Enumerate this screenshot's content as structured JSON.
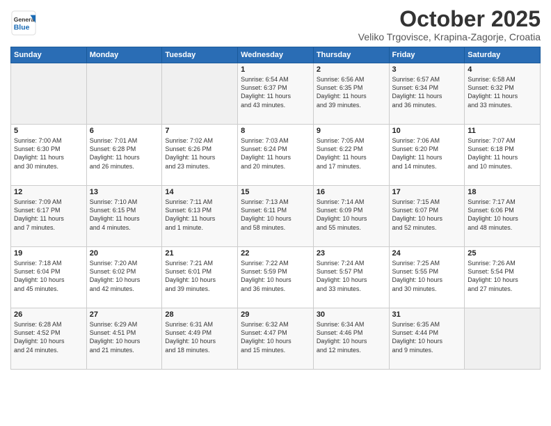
{
  "logo": {
    "general": "General",
    "blue": "Blue"
  },
  "header": {
    "title": "October 2025",
    "subtitle": "Veliko Trgovisce, Krapina-Zagorje, Croatia"
  },
  "days_of_week": [
    "Sunday",
    "Monday",
    "Tuesday",
    "Wednesday",
    "Thursday",
    "Friday",
    "Saturday"
  ],
  "weeks": [
    [
      {
        "num": "",
        "info": ""
      },
      {
        "num": "",
        "info": ""
      },
      {
        "num": "",
        "info": ""
      },
      {
        "num": "1",
        "info": "Sunrise: 6:54 AM\nSunset: 6:37 PM\nDaylight: 11 hours\nand 43 minutes."
      },
      {
        "num": "2",
        "info": "Sunrise: 6:56 AM\nSunset: 6:35 PM\nDaylight: 11 hours\nand 39 minutes."
      },
      {
        "num": "3",
        "info": "Sunrise: 6:57 AM\nSunset: 6:34 PM\nDaylight: 11 hours\nand 36 minutes."
      },
      {
        "num": "4",
        "info": "Sunrise: 6:58 AM\nSunset: 6:32 PM\nDaylight: 11 hours\nand 33 minutes."
      }
    ],
    [
      {
        "num": "5",
        "info": "Sunrise: 7:00 AM\nSunset: 6:30 PM\nDaylight: 11 hours\nand 30 minutes."
      },
      {
        "num": "6",
        "info": "Sunrise: 7:01 AM\nSunset: 6:28 PM\nDaylight: 11 hours\nand 26 minutes."
      },
      {
        "num": "7",
        "info": "Sunrise: 7:02 AM\nSunset: 6:26 PM\nDaylight: 11 hours\nand 23 minutes."
      },
      {
        "num": "8",
        "info": "Sunrise: 7:03 AM\nSunset: 6:24 PM\nDaylight: 11 hours\nand 20 minutes."
      },
      {
        "num": "9",
        "info": "Sunrise: 7:05 AM\nSunset: 6:22 PM\nDaylight: 11 hours\nand 17 minutes."
      },
      {
        "num": "10",
        "info": "Sunrise: 7:06 AM\nSunset: 6:20 PM\nDaylight: 11 hours\nand 14 minutes."
      },
      {
        "num": "11",
        "info": "Sunrise: 7:07 AM\nSunset: 6:18 PM\nDaylight: 11 hours\nand 10 minutes."
      }
    ],
    [
      {
        "num": "12",
        "info": "Sunrise: 7:09 AM\nSunset: 6:17 PM\nDaylight: 11 hours\nand 7 minutes."
      },
      {
        "num": "13",
        "info": "Sunrise: 7:10 AM\nSunset: 6:15 PM\nDaylight: 11 hours\nand 4 minutes."
      },
      {
        "num": "14",
        "info": "Sunrise: 7:11 AM\nSunset: 6:13 PM\nDaylight: 11 hours\nand 1 minute."
      },
      {
        "num": "15",
        "info": "Sunrise: 7:13 AM\nSunset: 6:11 PM\nDaylight: 10 hours\nand 58 minutes."
      },
      {
        "num": "16",
        "info": "Sunrise: 7:14 AM\nSunset: 6:09 PM\nDaylight: 10 hours\nand 55 minutes."
      },
      {
        "num": "17",
        "info": "Sunrise: 7:15 AM\nSunset: 6:07 PM\nDaylight: 10 hours\nand 52 minutes."
      },
      {
        "num": "18",
        "info": "Sunrise: 7:17 AM\nSunset: 6:06 PM\nDaylight: 10 hours\nand 48 minutes."
      }
    ],
    [
      {
        "num": "19",
        "info": "Sunrise: 7:18 AM\nSunset: 6:04 PM\nDaylight: 10 hours\nand 45 minutes."
      },
      {
        "num": "20",
        "info": "Sunrise: 7:20 AM\nSunset: 6:02 PM\nDaylight: 10 hours\nand 42 minutes."
      },
      {
        "num": "21",
        "info": "Sunrise: 7:21 AM\nSunset: 6:01 PM\nDaylight: 10 hours\nand 39 minutes."
      },
      {
        "num": "22",
        "info": "Sunrise: 7:22 AM\nSunset: 5:59 PM\nDaylight: 10 hours\nand 36 minutes."
      },
      {
        "num": "23",
        "info": "Sunrise: 7:24 AM\nSunset: 5:57 PM\nDaylight: 10 hours\nand 33 minutes."
      },
      {
        "num": "24",
        "info": "Sunrise: 7:25 AM\nSunset: 5:55 PM\nDaylight: 10 hours\nand 30 minutes."
      },
      {
        "num": "25",
        "info": "Sunrise: 7:26 AM\nSunset: 5:54 PM\nDaylight: 10 hours\nand 27 minutes."
      }
    ],
    [
      {
        "num": "26",
        "info": "Sunrise: 6:28 AM\nSunset: 4:52 PM\nDaylight: 10 hours\nand 24 minutes."
      },
      {
        "num": "27",
        "info": "Sunrise: 6:29 AM\nSunset: 4:51 PM\nDaylight: 10 hours\nand 21 minutes."
      },
      {
        "num": "28",
        "info": "Sunrise: 6:31 AM\nSunset: 4:49 PM\nDaylight: 10 hours\nand 18 minutes."
      },
      {
        "num": "29",
        "info": "Sunrise: 6:32 AM\nSunset: 4:47 PM\nDaylight: 10 hours\nand 15 minutes."
      },
      {
        "num": "30",
        "info": "Sunrise: 6:34 AM\nSunset: 4:46 PM\nDaylight: 10 hours\nand 12 minutes."
      },
      {
        "num": "31",
        "info": "Sunrise: 6:35 AM\nSunset: 4:44 PM\nDaylight: 10 hours\nand 9 minutes."
      },
      {
        "num": "",
        "info": ""
      }
    ]
  ]
}
